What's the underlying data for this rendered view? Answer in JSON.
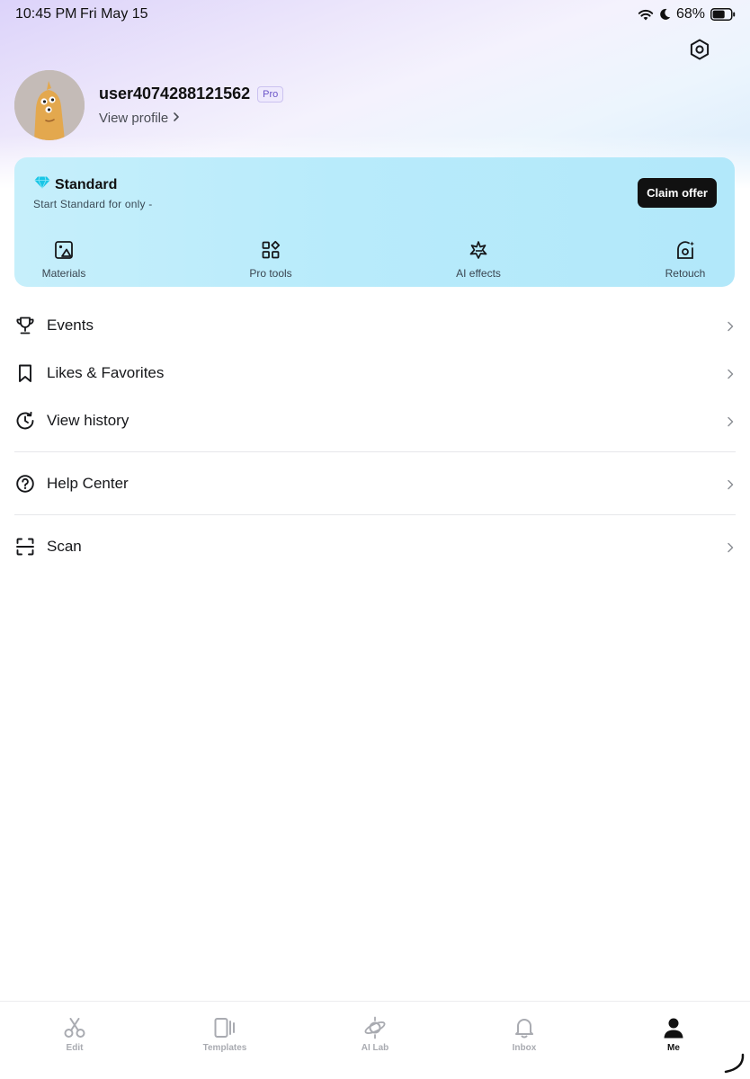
{
  "status_bar": {
    "time": "10:45 PM",
    "date": "Fri May 15",
    "battery_percent": "68%",
    "battery_level": 0.68,
    "icons": [
      "wifi-icon",
      "moon-icon",
      "battery-icon"
    ]
  },
  "header": {
    "settings_icon": "settings-gear-icon"
  },
  "profile": {
    "username": "user4074288121562",
    "badge": "Pro",
    "view_profile_label": "View profile"
  },
  "subscription_card": {
    "title": "Standard",
    "subtitle": "Start Standard for only -",
    "cta_label": "Claim offer",
    "features": [
      {
        "label": "Materials",
        "icon": "materials-image-icon"
      },
      {
        "label": "Pro tools",
        "icon": "pro-tools-grid-icon"
      },
      {
        "label": "AI effects",
        "icon": "ai-effects-sparkle-icon"
      },
      {
        "label": "Retouch",
        "icon": "retouch-face-icon"
      }
    ]
  },
  "menu": {
    "items": [
      {
        "label": "Events",
        "icon": "trophy-icon"
      },
      {
        "label": "Likes & Favorites",
        "icon": "bookmark-icon"
      },
      {
        "label": "View history",
        "icon": "history-clock-icon"
      },
      {
        "label": "Help Center",
        "icon": "help-circle-icon"
      },
      {
        "label": "Scan",
        "icon": "scan-icon"
      }
    ]
  },
  "tab_bar": {
    "active": "Me",
    "tabs": [
      {
        "label": "Edit",
        "icon": "scissors-icon"
      },
      {
        "label": "Templates",
        "icon": "templates-icon"
      },
      {
        "label": "AI Lab",
        "icon": "ai-lab-planet-icon"
      },
      {
        "label": "Inbox",
        "icon": "bell-icon"
      },
      {
        "label": "Me",
        "icon": "person-icon"
      }
    ]
  },
  "colors": {
    "accent_card": "#b8ebfb",
    "cta_background": "#111111",
    "pro_badge": "#6a54c8",
    "diamond": "#19c6e6"
  }
}
